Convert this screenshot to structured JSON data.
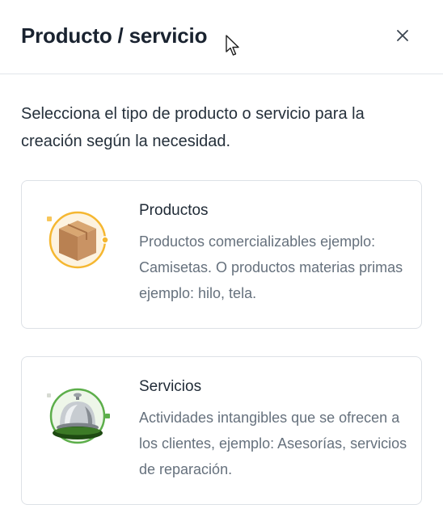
{
  "modal": {
    "title": "Producto / servicio",
    "intro": "Selecciona el tipo de producto o servicio para la creación según la necesidad."
  },
  "options": [
    {
      "title": "Productos",
      "description": "Productos comercializables ejemplo: Camisetas. O productos materias primas ejemplo: hilo, tela.",
      "icon": "cardboard-box-icon",
      "accent": "#f5b731"
    },
    {
      "title": "Servicios",
      "description": "Actividades intangibles que se ofrecen a los clientes, ejemplo: Asesorías, servicios de reparación.",
      "icon": "service-bell-icon",
      "accent": "#5cae4a"
    }
  ],
  "colors": {
    "title": "#1a2330",
    "text": "#25303b",
    "muted": "#66717d",
    "border": "#dde1e6"
  }
}
